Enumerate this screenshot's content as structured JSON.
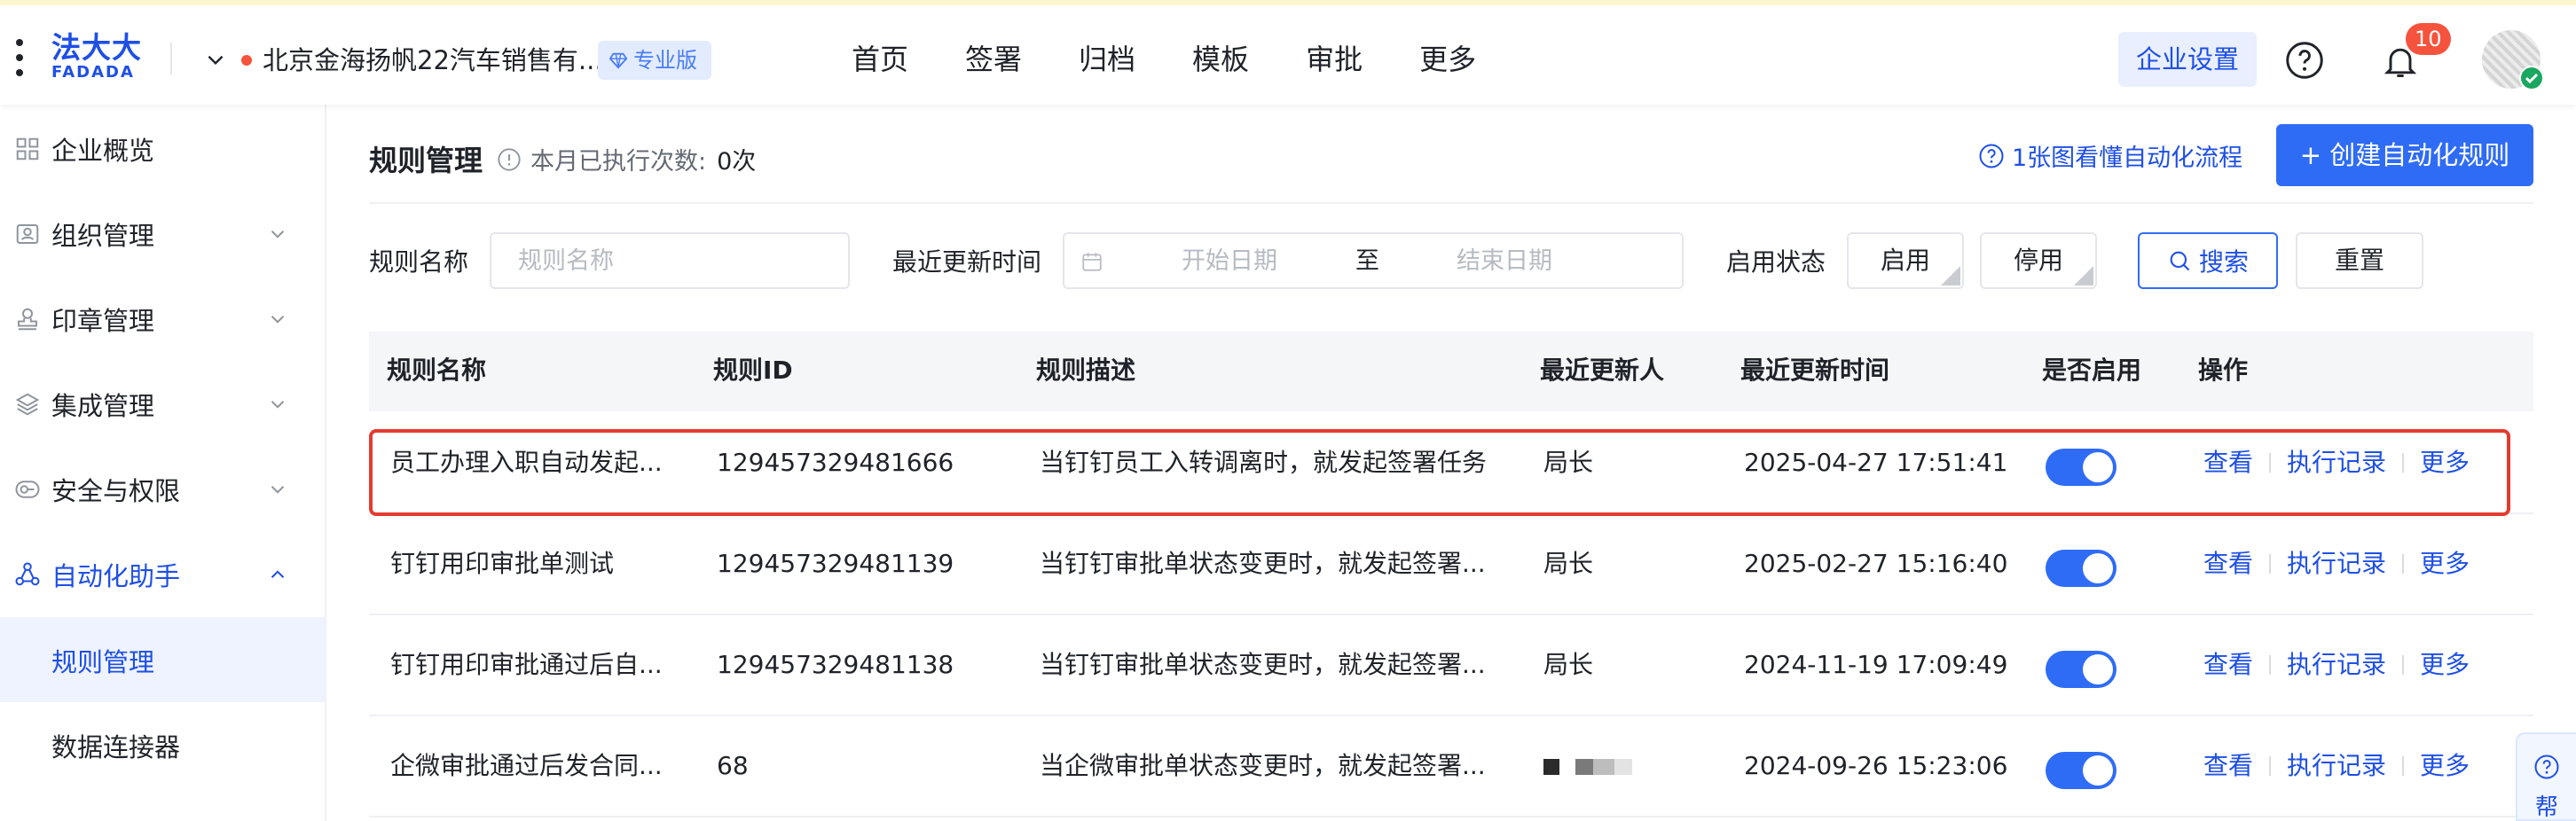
{
  "topbar": {
    "logo_cn": "法大大",
    "logo_en": "FADADA",
    "org_name": "北京金海扬帆22汽车销售有...",
    "edition": "专业版",
    "nav": [
      "首页",
      "签署",
      "归档",
      "模板",
      "审批",
      "更多"
    ],
    "corp_settings": "企业设置",
    "notification_count": "10",
    "status_color": "#f5533d"
  },
  "sidebar": {
    "items": [
      {
        "label": "企业概览",
        "icon": "overview-icon"
      },
      {
        "label": "组织管理",
        "icon": "org-icon"
      },
      {
        "label": "印章管理",
        "icon": "seal-icon"
      },
      {
        "label": "集成管理",
        "icon": "layers-icon"
      },
      {
        "label": "安全与权限",
        "icon": "security-icon"
      },
      {
        "label": "自动化助手",
        "icon": "automation-icon"
      }
    ],
    "sub_items": [
      "规则管理",
      "数据连接器"
    ],
    "active_item": "自动化助手",
    "selected_sub": "规则管理"
  },
  "main": {
    "title": "规则管理",
    "exec_label": "本月已执行次数:",
    "exec_value": "0次",
    "guide_link": "1张图看懂自动化流程",
    "create_button": "+ 创建自动化规则",
    "filters": {
      "name_label": "规则名称",
      "name_placeholder": "规则名称",
      "time_label": "最近更新时间",
      "start_placeholder": "开始日期",
      "to": "至",
      "end_placeholder": "结束日期",
      "status_label": "启用状态",
      "enabled": "启用",
      "disabled": "停用",
      "search": "搜索",
      "reset": "重置"
    },
    "table": {
      "columns": [
        "规则名称",
        "规则ID",
        "规则描述",
        "最近更新人",
        "最近更新时间",
        "是否启用",
        "操作"
      ],
      "rows": [
        {
          "name": "员工办理入职自动发起...",
          "id": "129457329481666",
          "desc": "当钉钉员工入转调离时，就发起签署任务",
          "updater": "局长",
          "time": "2025-04-27 17:51:41",
          "enabled": true
        },
        {
          "name": "钉钉用印审批单测试",
          "id": "129457329481139",
          "desc": "当钉钉审批单状态变更时，就发起签署...",
          "updater": "局长",
          "time": "2025-02-27 15:16:40",
          "enabled": true
        },
        {
          "name": "钉钉用印审批通过后自...",
          "id": "129457329481138",
          "desc": "当钉钉审批单状态变更时，就发起签署...",
          "updater": "局长",
          "time": "2024-11-19 17:09:49",
          "enabled": true
        },
        {
          "name": "企微审批通过后发合同...",
          "id": "68",
          "desc": "当企微审批单状态变更时，就发起签署...",
          "updater": "",
          "time": "2024-09-26 15:23:06",
          "enabled": true
        }
      ],
      "actions": [
        "查看",
        "执行记录",
        "更多"
      ]
    },
    "help_float": "帮"
  },
  "colors": {
    "primary": "#2f6cf6",
    "highlight": "#e53a2f"
  }
}
